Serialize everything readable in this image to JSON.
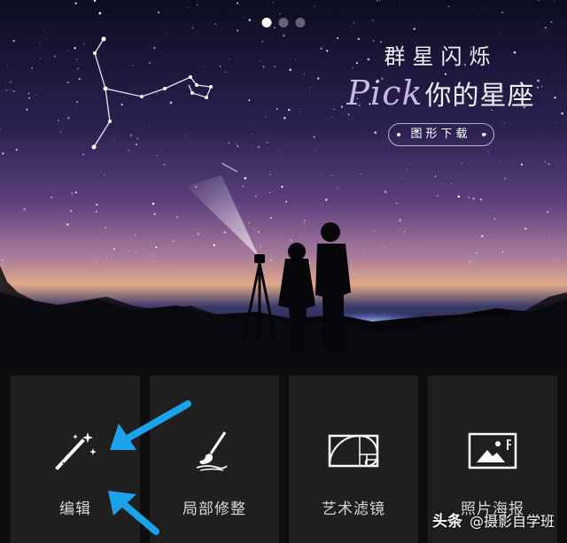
{
  "banner": {
    "carousel_dots": 3,
    "active_dot": 0,
    "title": "群星闪烁",
    "subtitle_script": "Pick",
    "subtitle": "你的星座",
    "button_label": "图形下载"
  },
  "tools": [
    {
      "label": "编辑",
      "icon": "magic-wand-icon"
    },
    {
      "label": "局部修整",
      "icon": "brush-icon"
    },
    {
      "label": "艺术滤镜",
      "icon": "golden-ratio-icon"
    },
    {
      "label": "照片海报",
      "icon": "poster-icon"
    }
  ],
  "annotations": {
    "arrow_color": "#1aa3e8",
    "arrows": 2
  },
  "watermark": {
    "brand": "头条",
    "handle": "@摄影自学班"
  },
  "colors": {
    "tile_bg": "#1f1f1f",
    "page_bg": "#0d0d0f",
    "label": "#d6d6d6"
  }
}
